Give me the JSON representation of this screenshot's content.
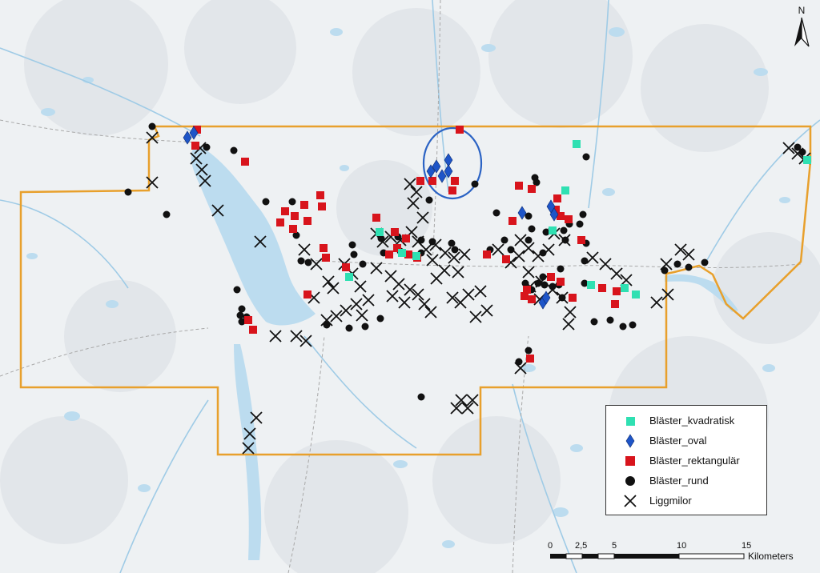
{
  "colors": {
    "boundary": "#e8a02c",
    "highlight_ellipse": "#2b63c4",
    "kvadratisk": "#2fe0b2",
    "oval": "#1e55c8",
    "rektangular": "#d8141c",
    "rund": "#111111",
    "liggmilor": "#111111",
    "water": "#bcdcef",
    "land": "#eef1f3"
  },
  "legend": {
    "items": [
      {
        "label": "Bläster_kvadratisk",
        "symbol": "square-teal"
      },
      {
        "label": "Bläster_oval",
        "symbol": "diamond-blue"
      },
      {
        "label": "Bläster_rektangulär",
        "symbol": "square-red"
      },
      {
        "label": "Bläster_rund",
        "symbol": "circle-black"
      },
      {
        "label": "Liggmilor",
        "symbol": "x-cross"
      }
    ]
  },
  "north_arrow": {
    "label": "N"
  },
  "scale_bar": {
    "ticks": [
      "0",
      "2,5",
      "5",
      "10",
      "15"
    ],
    "unit": "Kilometers"
  }
}
